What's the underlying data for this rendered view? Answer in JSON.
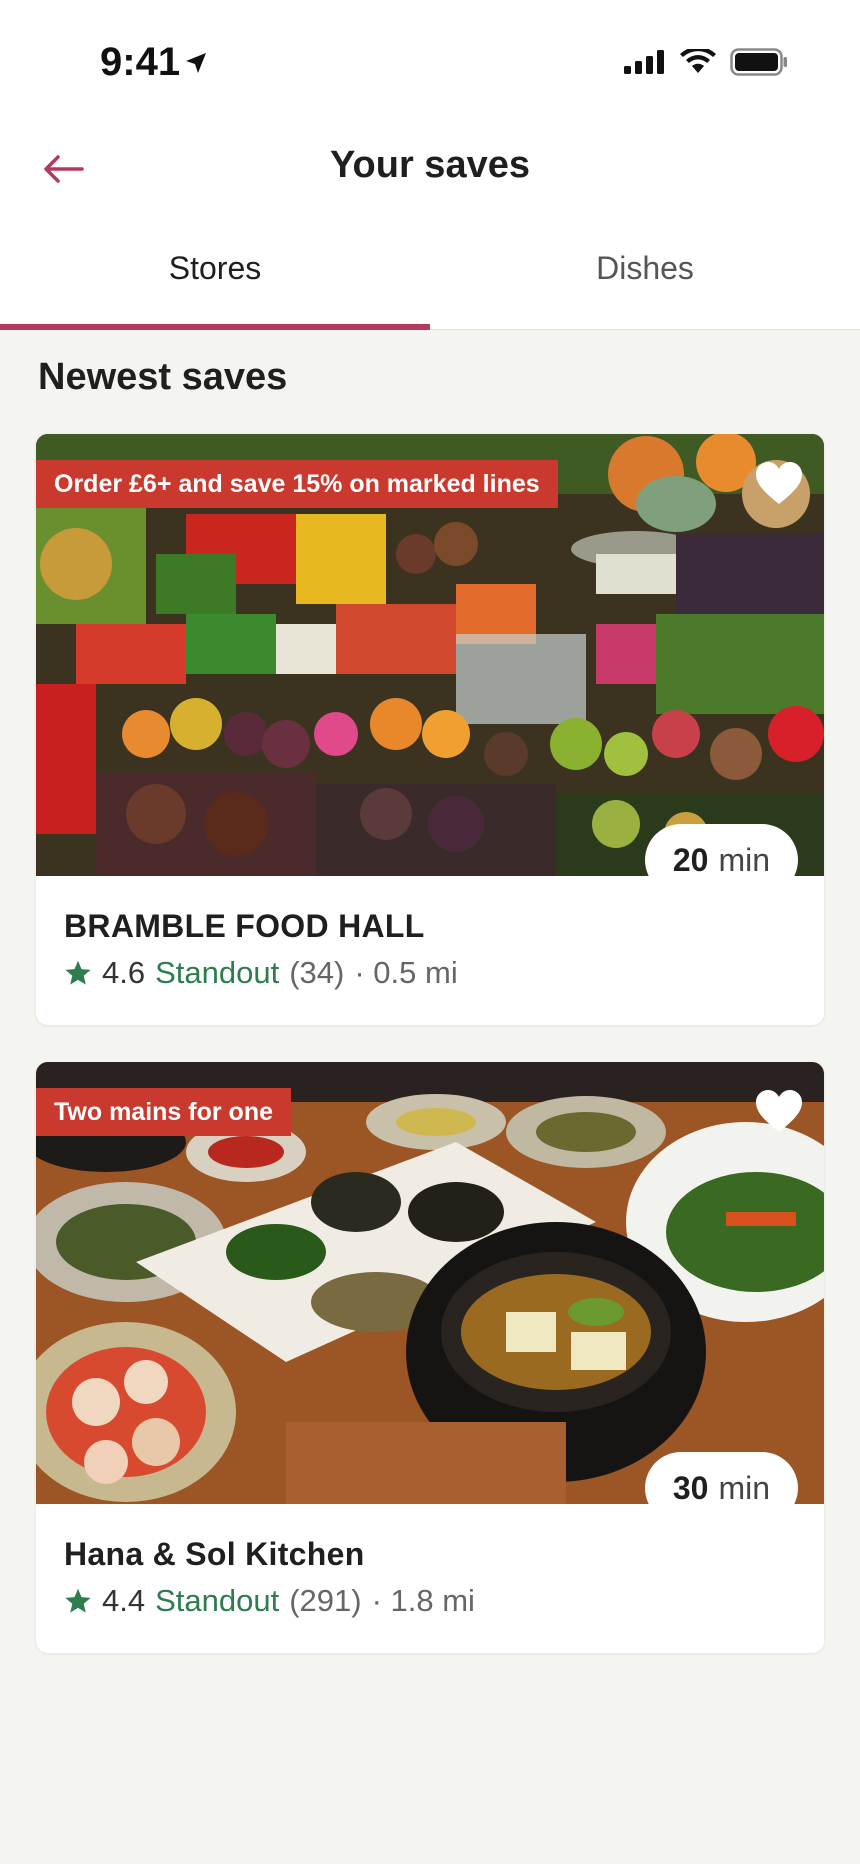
{
  "status": {
    "time": "9:41"
  },
  "header": {
    "title": "Your saves"
  },
  "tabs": [
    {
      "label": "Stores"
    },
    {
      "label": "Dishes"
    }
  ],
  "section": {
    "title": "Newest saves"
  },
  "stores": [
    {
      "promo": "Order £6+ and save 15% on marked lines",
      "eta_value": "20",
      "eta_unit": "min",
      "name": "BRAMBLE FOOD HALL",
      "rating": "4.6",
      "badge": "Standout",
      "reviews": "(34)",
      "distance": "· 0.5 mi"
    },
    {
      "promo": "Two mains for one",
      "eta_value": "30",
      "eta_unit": "min",
      "name": "Hana & Sol Kitchen",
      "rating": "4.4",
      "badge": "Standout",
      "reviews": "(291)",
      "distance": "· 1.8 mi"
    }
  ],
  "colors": {
    "accent": "#b23a5c",
    "promo": "#c9392e",
    "standout": "#2e7d4f",
    "background": "#f4f4f1"
  },
  "icons": [
    "back-arrow-icon",
    "heart-icon",
    "star-icon",
    "location-arrow-icon",
    "signal-icon",
    "wifi-icon",
    "battery-icon"
  ]
}
